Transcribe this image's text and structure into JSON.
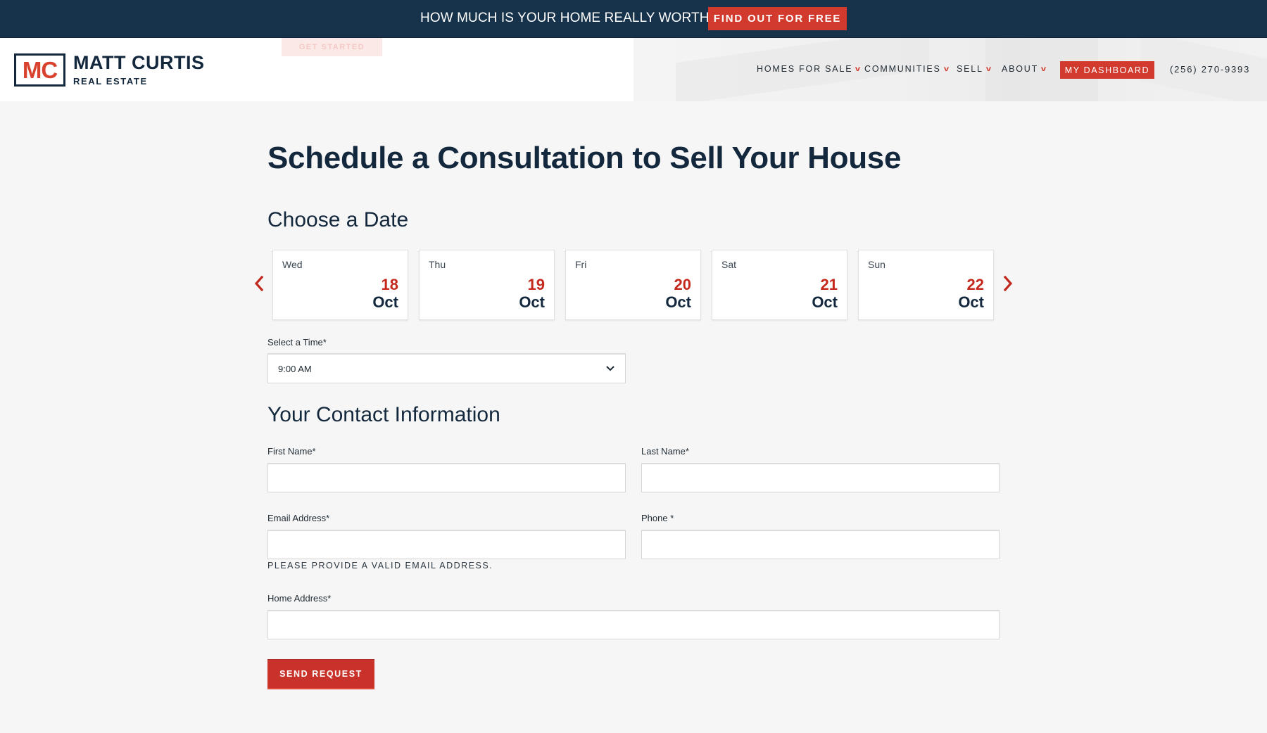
{
  "topbar": {
    "promo_text": "HOW MUCH IS YOUR HOME REALLY WORTH?",
    "cta_label": "FIND OUT FOR FREE"
  },
  "header": {
    "ghost_button_label": "GET STARTED",
    "logo": {
      "monogram": "MC",
      "name": "MATT CURTIS",
      "subtitle": "REAL ESTATE"
    },
    "nav": [
      {
        "label": "HOMES FOR SALE",
        "has_dropdown": true
      },
      {
        "label": "COMMUNITIES",
        "has_dropdown": true
      },
      {
        "label": "SELL",
        "has_dropdown": true
      },
      {
        "label": "ABOUT",
        "has_dropdown": true
      }
    ],
    "dashboard_label": "MY DASHBOARD",
    "phone": "(256) 270-9393",
    "dropdown_glyph": "v"
  },
  "main": {
    "title": "Schedule a Consultation to Sell Your House",
    "date_section": {
      "heading": "Choose a Date",
      "prev_icon": "chevron-left-icon",
      "next_icon": "chevron-right-icon",
      "dates": [
        {
          "weekday": "Wed",
          "day": "18",
          "month": "Oct"
        },
        {
          "weekday": "Thu",
          "day": "19",
          "month": "Oct"
        },
        {
          "weekday": "Fri",
          "day": "20",
          "month": "Oct"
        },
        {
          "weekday": "Sat",
          "day": "21",
          "month": "Oct"
        },
        {
          "weekday": "Sun",
          "day": "22",
          "month": "Oct"
        }
      ]
    },
    "time": {
      "label": "Select a Time*",
      "selected": "9:00 AM"
    },
    "contact": {
      "heading": "Your Contact Information",
      "first_name": {
        "label": "First Name*",
        "value": ""
      },
      "last_name": {
        "label": "Last Name*",
        "value": ""
      },
      "email": {
        "label": "Email Address*",
        "value": "",
        "hint": "PLEASE PROVIDE A VALID EMAIL ADDRESS."
      },
      "phone": {
        "label": "Phone *",
        "value": ""
      },
      "home_address": {
        "label": "Home Address*",
        "value": ""
      }
    },
    "submit_label": "SEND REQUEST"
  },
  "colors": {
    "navy": "#16334b",
    "accent_red": "#d13a2c",
    "text_dark": "#13283c",
    "background": "#f6f6f6"
  }
}
